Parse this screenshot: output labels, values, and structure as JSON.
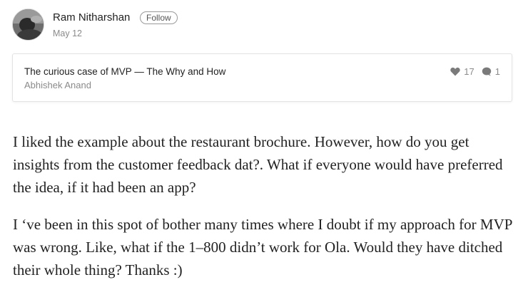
{
  "response": {
    "author": {
      "name": "Ram Nitharshan",
      "follow_label": "Follow",
      "date": "May 12"
    },
    "quoted_story": {
      "title": "The curious case of MVP — The Why and How",
      "author": "Abhishek Anand",
      "likes": "17",
      "responses": "1"
    },
    "body": {
      "paragraphs": [
        "I liked the example about the restaurant brochure. However, how do you get insights from the customer feedback dat?. What if everyone would have preferred the idea, if it had been an app?",
        "I ‘ve been in this spot of bother many times where I doubt if my approach for MVP was wrong. Like, what if the 1–800 didn’t work for Ola. Would they have ditched their whole thing? Thanks :)"
      ]
    }
  },
  "icons": {
    "like": "heart-icon",
    "response": "speech-bubble-icon"
  },
  "colors": {
    "text": "#222222",
    "muted": "#8a8a8a",
    "card_border": "#e3e3e3"
  }
}
